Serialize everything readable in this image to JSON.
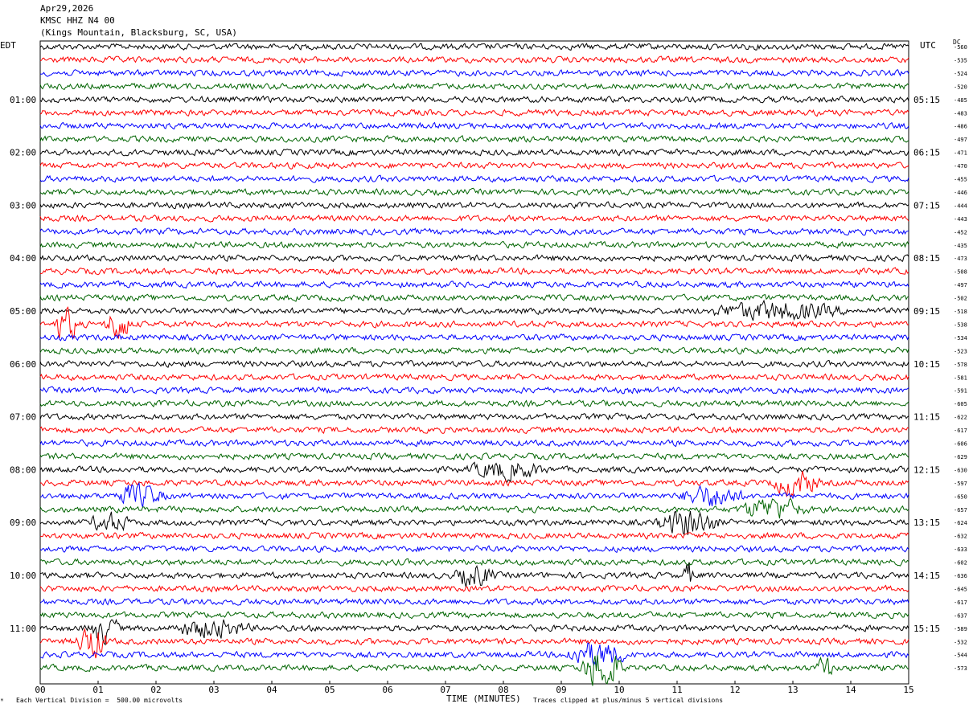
{
  "header": {
    "date": "Apr29,2026",
    "station": "KMSC HHZ N4 00",
    "location": "(Kings Mountain, Blacksburg, SC, USA)"
  },
  "left_tz": "EDT",
  "right_tz": "UTC",
  "dc_label": "DC",
  "footer": {
    "scale": "Each Vertical Division =  500.00 microvolts",
    "xlabel": "TIME (MINUTES)",
    "clip_note": "Traces clipped at plus/minus 5 vertical divisions",
    "corner_mark": "ᴹ"
  },
  "colors": {
    "black": "#000000",
    "red": "#ff0000",
    "blue": "#0000ff",
    "green": "#006400"
  },
  "chart_data": {
    "type": "line",
    "title": "KMSC HHZ N4 00",
    "xlabel": "TIME (MINUTES)",
    "xlim": [
      0,
      15
    ],
    "x_ticks": [
      "00",
      "01",
      "02",
      "03",
      "04",
      "05",
      "06",
      "07",
      "08",
      "09",
      "10",
      "11",
      "12",
      "13",
      "14",
      "15"
    ],
    "trace_colors": [
      "black",
      "red",
      "blue",
      "green"
    ],
    "traces_per_hour": 4,
    "minutes_per_trace": 15,
    "edt_labels": [
      {
        "trace": 4,
        "label": "01:00"
      },
      {
        "trace": 8,
        "label": "02:00"
      },
      {
        "trace": 12,
        "label": "03:00"
      },
      {
        "trace": 16,
        "label": "04:00"
      },
      {
        "trace": 20,
        "label": "05:00"
      },
      {
        "trace": 24,
        "label": "06:00"
      },
      {
        "trace": 28,
        "label": "07:00"
      },
      {
        "trace": 32,
        "label": "08:00"
      },
      {
        "trace": 36,
        "label": "09:00"
      },
      {
        "trace": 40,
        "label": "10:00"
      },
      {
        "trace": 44,
        "label": "11:00"
      }
    ],
    "utc_labels": [
      {
        "trace": 4,
        "label": "05:15"
      },
      {
        "trace": 8,
        "label": "06:15"
      },
      {
        "trace": 12,
        "label": "07:15"
      },
      {
        "trace": 16,
        "label": "08:15"
      },
      {
        "trace": 20,
        "label": "09:15"
      },
      {
        "trace": 24,
        "label": "10:15"
      },
      {
        "trace": 28,
        "label": "11:15"
      },
      {
        "trace": 32,
        "label": "12:15"
      },
      {
        "trace": 36,
        "label": "13:15"
      },
      {
        "trace": 40,
        "label": "14:15"
      },
      {
        "trace": 44,
        "label": "15:15"
      }
    ],
    "dc_offsets": [
      "-560",
      "-535",
      "-524",
      "-520",
      "-485",
      "-483",
      "-486",
      "-497",
      "-471",
      "-470",
      "-455",
      "-446",
      "-444",
      "-443",
      "-452",
      "-435",
      "-473",
      "-508",
      "-497",
      "-502",
      "-518",
      "-538",
      "-534",
      "-523",
      "-578",
      "-581",
      "-591",
      "-605",
      "-622",
      "-617",
      "-606",
      "-629",
      "-630",
      "-597",
      "-650",
      "-657",
      "-624",
      "-632",
      "-633",
      "-602",
      "-636",
      "-645",
      "-617",
      "-637",
      "-589",
      "-532",
      "-544",
      "-573"
    ],
    "events": [
      {
        "trace": 21,
        "minute": 0.2,
        "duration": 0.5,
        "amp": 4
      },
      {
        "trace": 21,
        "minute": 1.1,
        "duration": 0.5,
        "amp": 4
      },
      {
        "trace": 20,
        "minute": 11.4,
        "duration": 2.6,
        "amp": 2
      },
      {
        "trace": 32,
        "minute": 7.3,
        "duration": 1.5,
        "amp": 2
      },
      {
        "trace": 33,
        "minute": 12.6,
        "duration": 0.9,
        "amp": 3
      },
      {
        "trace": 34,
        "minute": 1.2,
        "duration": 1.0,
        "amp": 2.5
      },
      {
        "trace": 34,
        "minute": 11.0,
        "duration": 1.2,
        "amp": 2.5
      },
      {
        "trace": 35,
        "minute": 12.0,
        "duration": 1.3,
        "amp": 2.5
      },
      {
        "trace": 36,
        "minute": 0.8,
        "duration": 0.8,
        "amp": 2
      },
      {
        "trace": 36,
        "minute": 10.6,
        "duration": 1.2,
        "amp": 3
      },
      {
        "trace": 40,
        "minute": 7.1,
        "duration": 0.8,
        "amp": 2.5
      },
      {
        "trace": 40,
        "minute": 11.1,
        "duration": 0.2,
        "amp": 3
      },
      {
        "trace": 44,
        "minute": 0.8,
        "duration": 0.6,
        "amp": 3
      },
      {
        "trace": 44,
        "minute": 2.2,
        "duration": 1.5,
        "amp": 2
      },
      {
        "trace": 45,
        "minute": 0.6,
        "duration": 0.6,
        "amp": 4
      },
      {
        "trace": 46,
        "minute": 9.0,
        "duration": 1.2,
        "amp": 3
      },
      {
        "trace": 47,
        "minute": 9.3,
        "duration": 0.8,
        "amp": 5
      },
      {
        "trace": 47,
        "minute": 13.4,
        "duration": 0.3,
        "amp": 3
      }
    ]
  }
}
